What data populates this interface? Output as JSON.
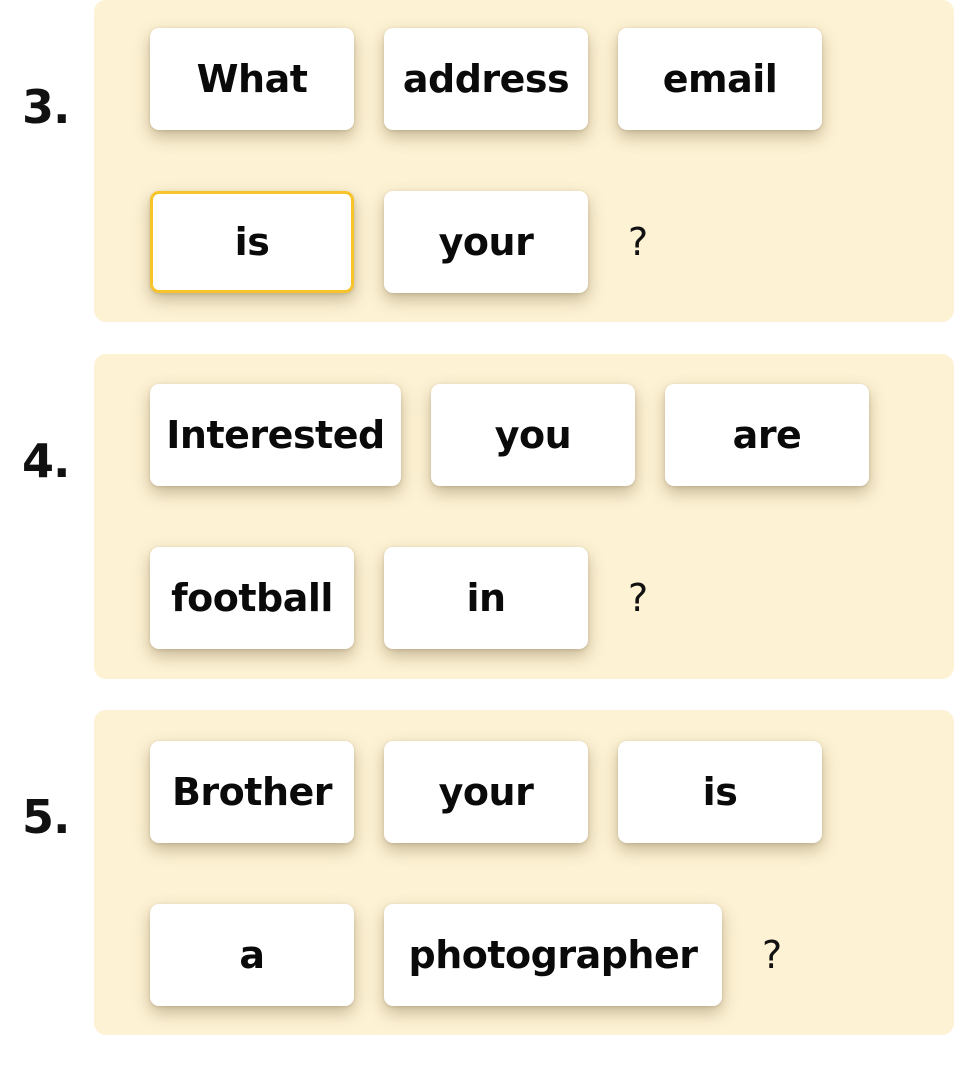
{
  "colors": {
    "panel_background": "#FDF2D4",
    "tile_background": "#FFFFFF",
    "selected_border": "#F8C42B",
    "text": "#0A0A0A"
  },
  "questions": [
    {
      "number": "3.",
      "rows": [
        [
          {
            "word": "What",
            "selected": false
          },
          {
            "word": "address",
            "selected": false
          },
          {
            "word": "email",
            "selected": false
          }
        ],
        [
          {
            "word": "is",
            "selected": true
          },
          {
            "word": "your",
            "selected": false
          }
        ]
      ],
      "end_mark": "?"
    },
    {
      "number": "4.",
      "rows": [
        [
          {
            "word": "Interested",
            "selected": false
          },
          {
            "word": "you",
            "selected": false
          },
          {
            "word": "are",
            "selected": false
          }
        ],
        [
          {
            "word": "football",
            "selected": false
          },
          {
            "word": "in",
            "selected": false
          }
        ]
      ],
      "end_mark": "?"
    },
    {
      "number": "5.",
      "rows": [
        [
          {
            "word": "Brother",
            "selected": false
          },
          {
            "word": "your",
            "selected": false
          },
          {
            "word": "is",
            "selected": false
          }
        ],
        [
          {
            "word": "a",
            "selected": false
          },
          {
            "word": "photographer",
            "selected": false
          }
        ]
      ],
      "end_mark": "?"
    }
  ]
}
